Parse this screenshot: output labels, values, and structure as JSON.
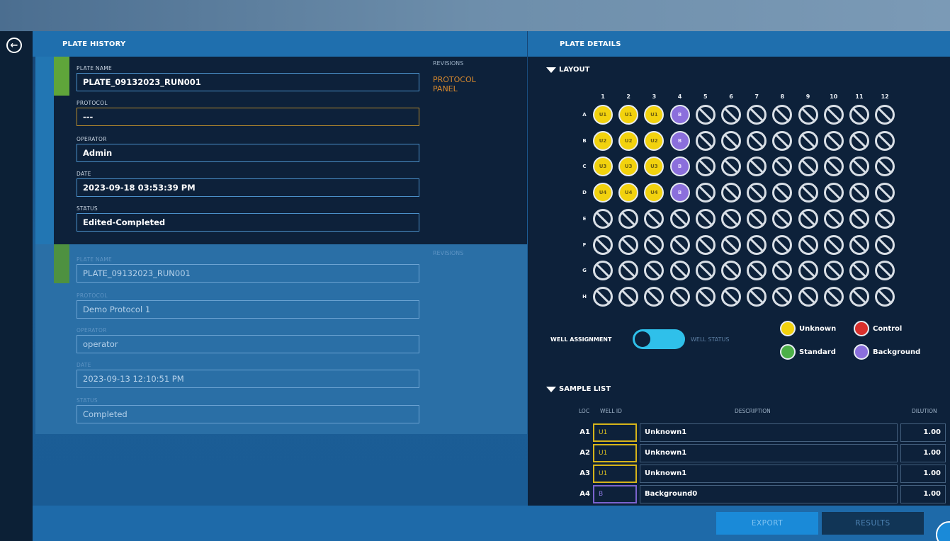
{
  "headers": {
    "left": "PLATE HISTORY",
    "right": "PLATE DETAILS"
  },
  "history": [
    {
      "plate_name_label": "PLATE NAME",
      "plate_name": "PLATE_09132023_RUN001",
      "protocol_label": "PROTOCOL",
      "protocol": "---",
      "operator_label": "OPERATOR",
      "operator": "Admin",
      "date_label": "DATE",
      "date": "2023-09-18 03:53:39 PM",
      "status_label": "STATUS",
      "status": "Edited-Completed",
      "revisions_label": "REVISIONS",
      "revision_items": [
        "PROTOCOL",
        "PANEL"
      ]
    },
    {
      "plate_name_label": "PLATE NAME",
      "plate_name": "PLATE_09132023_RUN001",
      "protocol_label": "PROTOCOL",
      "protocol": "Demo Protocol 1",
      "operator_label": "OPERATOR",
      "operator": "operator",
      "date_label": "DATE",
      "date": "2023-09-13 12:10:51 PM",
      "status_label": "STATUS",
      "status": "Completed",
      "revisions_label": "REVISIONS"
    }
  ],
  "layout": {
    "title": "LAYOUT",
    "columns": [
      "1",
      "2",
      "3",
      "4",
      "5",
      "6",
      "7",
      "8",
      "9",
      "10",
      "11",
      "12"
    ],
    "rows": [
      "A",
      "B",
      "C",
      "D",
      "E",
      "F",
      "G",
      "H"
    ],
    "wells": {
      "A": [
        [
          "unknown",
          "U1"
        ],
        [
          "unknown",
          "U1"
        ],
        [
          "unknown",
          "U1"
        ],
        [
          "background",
          "B"
        ]
      ],
      "B": [
        [
          "unknown",
          "U2"
        ],
        [
          "unknown",
          "U2"
        ],
        [
          "unknown",
          "U2"
        ],
        [
          "background",
          "B"
        ]
      ],
      "C": [
        [
          "unknown",
          "U3"
        ],
        [
          "unknown",
          "U3"
        ],
        [
          "unknown",
          "U3"
        ],
        [
          "background",
          "B"
        ]
      ],
      "D": [
        [
          "unknown",
          "U4"
        ],
        [
          "unknown",
          "U4"
        ],
        [
          "unknown",
          "U4"
        ],
        [
          "background",
          "B"
        ]
      ]
    }
  },
  "toggle": {
    "left_label": "WELL ASSIGNMENT",
    "right_label": "WELL STATUS"
  },
  "legend": [
    {
      "label": "Unknown",
      "color": "#f2d20e"
    },
    {
      "label": "Control",
      "color": "#d9302c"
    },
    {
      "label": "Standard",
      "color": "#4db048"
    },
    {
      "label": "Background",
      "color": "#8b6fdc"
    }
  ],
  "sample_list": {
    "title": "SAMPLE LIST",
    "headers": {
      "loc": "LOC",
      "well_id": "WELL ID",
      "description": "DESCRIPTION",
      "dilution": "DILUTION"
    },
    "rows": [
      {
        "loc": "A1",
        "well_id": "U1",
        "type": "unknown",
        "description": "Unknown1",
        "dilution": "1.00"
      },
      {
        "loc": "A2",
        "well_id": "U1",
        "type": "unknown",
        "description": "Unknown1",
        "dilution": "1.00"
      },
      {
        "loc": "A3",
        "well_id": "U1",
        "type": "unknown",
        "description": "Unknown1",
        "dilution": "1.00"
      },
      {
        "loc": "A4",
        "well_id": "B",
        "type": "background",
        "description": "Background0",
        "dilution": "1.00"
      }
    ]
  },
  "buttons": {
    "export": "EXPORT",
    "results": "RESULTS"
  }
}
